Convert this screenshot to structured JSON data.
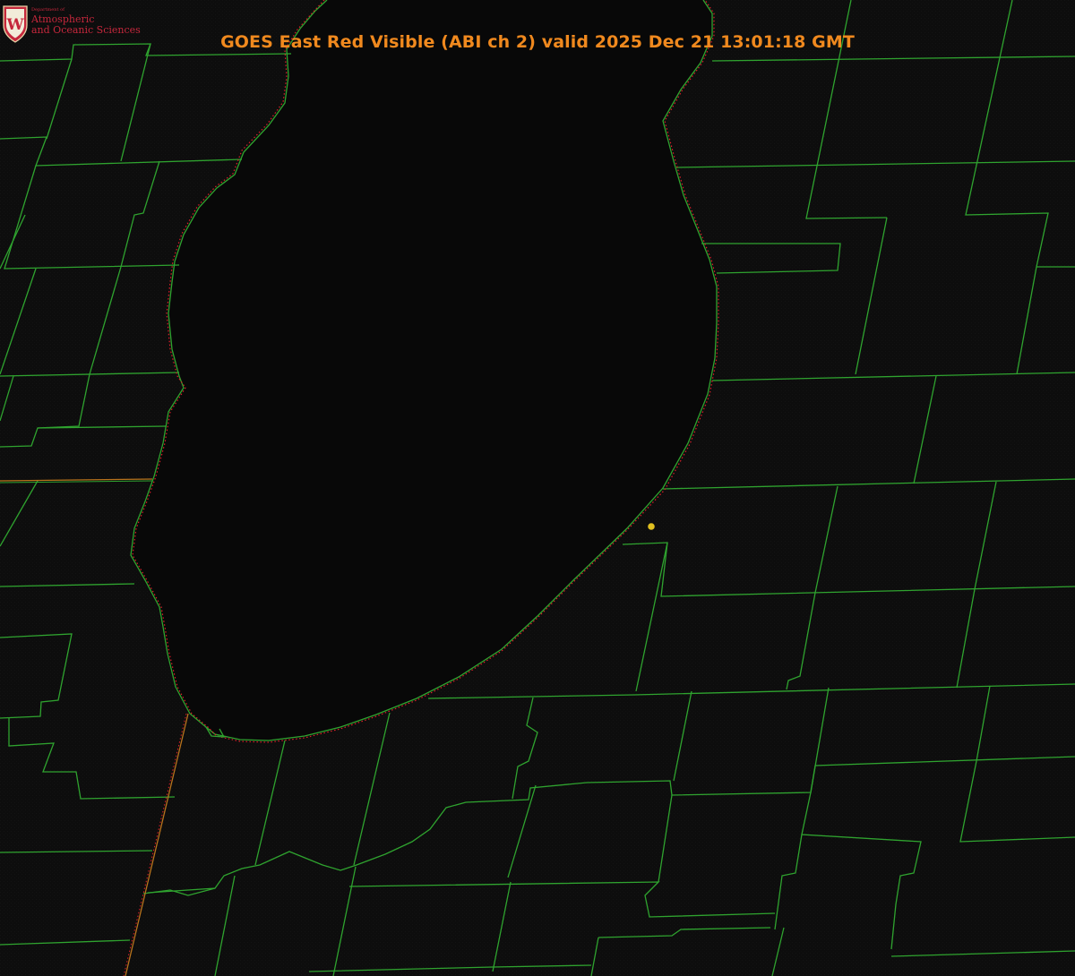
{
  "map": {
    "title": "GOES East Red Visible (ABI ch 2) valid 2025 Dec 21 13:01:18 GMT",
    "satellite": "GOES East",
    "channel": "Red Visible (ABI ch 2)",
    "valid_time": "2025 Dec 21 13:01:18 GMT",
    "colors": {
      "background": "#0c0c0c",
      "lake": "#080808",
      "county_lines": "#2fa32f",
      "state_line": "#b8731c",
      "coastline": "#e0202a",
      "marker": "#e0c020",
      "title": "#f0891e"
    },
    "marker": {
      "type": "station-dot"
    }
  },
  "logo": {
    "letter": "W",
    "department": "Department of",
    "line1": "Atmospheric",
    "line2": "and Oceanic Sciences"
  }
}
